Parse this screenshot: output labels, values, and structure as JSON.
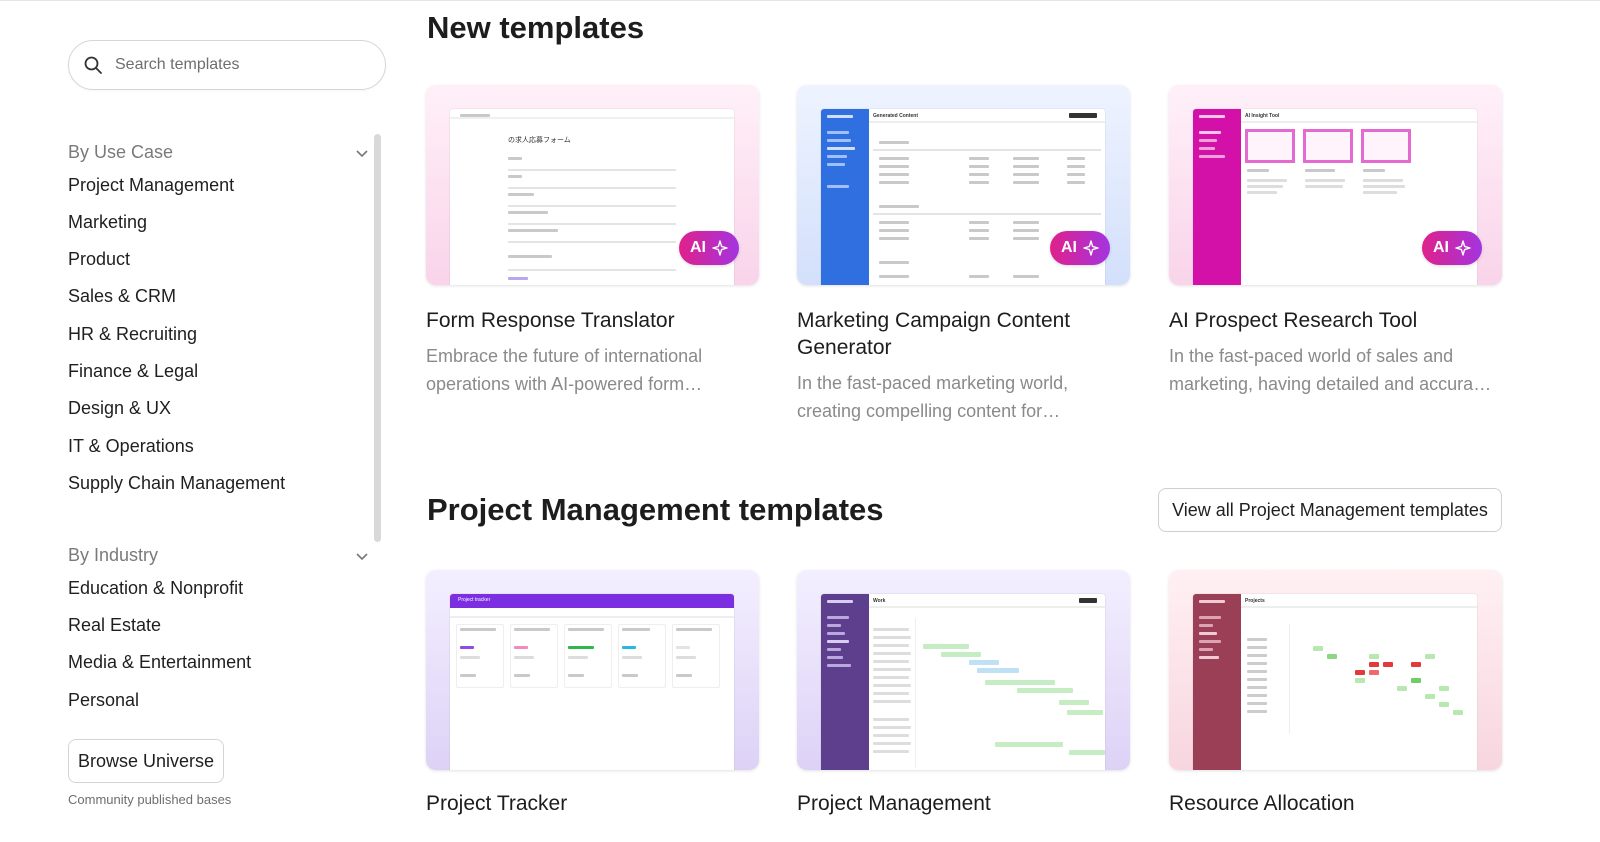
{
  "search": {
    "placeholder": "Search templates"
  },
  "sidebar": {
    "use_case": {
      "heading": "By Use Case",
      "items": [
        "Project Management",
        "Marketing",
        "Product",
        "Sales & CRM",
        "HR & Recruiting",
        "Finance & Legal",
        "Design & UX",
        "IT & Operations",
        "Supply Chain Management"
      ]
    },
    "industry": {
      "heading": "By Industry",
      "items": [
        "Education & Nonprofit",
        "Real Estate",
        "Media & Entertainment",
        "Personal"
      ]
    },
    "browse": {
      "label": "Browse Universe",
      "sub": "Community published bases"
    }
  },
  "new_templates": {
    "title": "New templates",
    "cards": [
      {
        "title": "Form Response Translator",
        "desc": "Embrace the future of international operations with AI-powered form…",
        "badge": "AI",
        "thumb_title": "の求人応募フォーム"
      },
      {
        "title": "Marketing Campaign Content Generator",
        "desc": "In the fast-paced marketing world, creating compelling content for…",
        "badge": "AI",
        "thumb_title": "Generated Content"
      },
      {
        "title": "AI Prospect Research Tool",
        "desc": "In the fast-paced world of sales and marketing, having detailed and accura…",
        "badge": "AI",
        "thumb_title": "AI Insight Tool"
      }
    ]
  },
  "pm_templates": {
    "title": "Project Management templates",
    "view_all": "View all Project Management templates",
    "cards": [
      {
        "title": "Project Tracker",
        "thumb_title": "Project tracker"
      },
      {
        "title": "Project Management",
        "thumb_title": "Work"
      },
      {
        "title": "Resource Allocation",
        "thumb_title": "Projects"
      }
    ]
  },
  "colors": {
    "ai_gradient_start": "#e0218a",
    "ai_gradient_end": "#a334e0",
    "blue_sidebar": "#2f6fe0",
    "magenta_sidebar": "#d311a8",
    "purple_header": "#7b2fe0",
    "violet_sidebar": "#5e3f8e",
    "maroon_sidebar": "#9a3f55"
  }
}
